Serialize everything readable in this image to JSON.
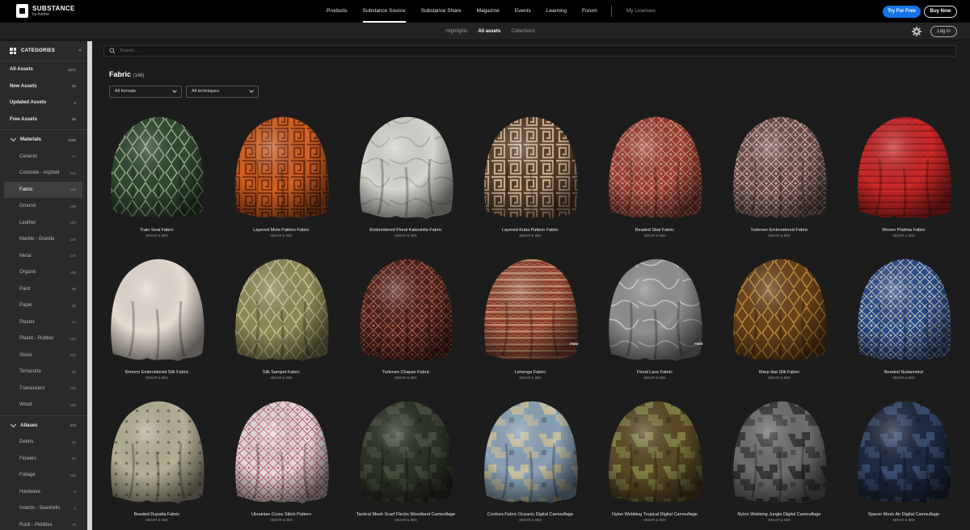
{
  "brand": {
    "name": "SUBSTANCE",
    "byline": "by Adobe"
  },
  "nav": [
    {
      "label": "Products",
      "active": false
    },
    {
      "label": "Substance Source",
      "active": true
    },
    {
      "label": "Substance Share",
      "active": false
    },
    {
      "label": "Magazine",
      "active": false
    },
    {
      "label": "Events",
      "active": false
    },
    {
      "label": "Learning",
      "active": false
    },
    {
      "label": "Forum",
      "active": false
    }
  ],
  "nav_secondary": "My Licenses",
  "cta": {
    "try": "Try For Free",
    "buy": "Buy Now"
  },
  "subtabs": [
    {
      "label": "Highlights",
      "active": false
    },
    {
      "label": "All assets",
      "active": true
    },
    {
      "label": "Collections",
      "active": false
    }
  ],
  "account": {
    "login": "Log in"
  },
  "sidebar": {
    "title": "CATEGORIES",
    "collapse": "«",
    "top": [
      {
        "label": "All Assets",
        "count": "1471"
      },
      {
        "label": "New Assets",
        "count": "31"
      },
      {
        "label": "Updated Assets",
        "count": "3"
      },
      {
        "label": "Free Assets",
        "count": "56"
      }
    ],
    "materials": {
      "label": "Materials",
      "count": "1005"
    },
    "material_items": [
      {
        "label": "Ceramic",
        "count": "47"
      },
      {
        "label": "Concrete - Asphalt",
        "count": "210"
      },
      {
        "label": "Fabric",
        "count": "146"
      },
      {
        "label": "Ground",
        "count": "186"
      },
      {
        "label": "Leather",
        "count": "104"
      },
      {
        "label": "Marble - Granite",
        "count": "109"
      },
      {
        "label": "Metal",
        "count": "176"
      },
      {
        "label": "Organic",
        "count": "108"
      },
      {
        "label": "Paint",
        "count": "58"
      },
      {
        "label": "Paper",
        "count": "35"
      },
      {
        "label": "Plaster",
        "count": "44"
      },
      {
        "label": "Plastic - Rubber",
        "count": "107"
      },
      {
        "label": "Stone",
        "count": "222"
      },
      {
        "label": "Terracotta",
        "count": "50"
      },
      {
        "label": "Translucent",
        "count": "103"
      },
      {
        "label": "Wood",
        "count": "150"
      }
    ],
    "atlases": {
      "label": "Atlases",
      "count": "474"
    },
    "atlas_items": [
      {
        "label": "Debris",
        "count": "33"
      },
      {
        "label": "Flowers",
        "count": "52"
      },
      {
        "label": "Foliage",
        "count": "220"
      },
      {
        "label": "Hardware",
        "count": "9"
      },
      {
        "label": "Insects - Seashells",
        "count": "3"
      },
      {
        "label": "Rock - Pebbles",
        "count": "78"
      }
    ]
  },
  "search": {
    "placeholder": "Search..."
  },
  "page": {
    "title": "Fabric",
    "count": "(146)"
  },
  "filters": {
    "formats": "All formats",
    "techniques": "All techniques"
  },
  "assets": [
    {
      "name": "Train Seat Fabric",
      "meta": "SBSAR & SBS",
      "free": false,
      "base": "#2f4a2f",
      "accent": "#b9c7a6",
      "pattern": "diamond"
    },
    {
      "name": "Layered Mola Pattern Fabric",
      "meta": "SBSAR & SBS",
      "free": false,
      "base": "#d9621e",
      "accent": "#6d2a16",
      "pattern": "maze"
    },
    {
      "name": "Embroidered Floral Kakeshita Fabric",
      "meta": "SBSAR & SBS",
      "free": false,
      "base": "#d6d6d0",
      "accent": "#a7a79b",
      "pattern": "marble"
    },
    {
      "name": "Layered Kuba Pattern Fabric",
      "meta": "SBSAR & SBS",
      "free": false,
      "base": "#5a3c26",
      "accent": "#d8c7a8",
      "pattern": "maze"
    },
    {
      "name": "Beaded Sbai Fabric",
      "meta": "SBSAR & SBS",
      "free": false,
      "base": "#9b3a2e",
      "accent": "#d9b8a2",
      "pattern": "lattice"
    },
    {
      "name": "Turkmen Embroidered Fabric",
      "meta": "SBSAR & SBS",
      "free": false,
      "base": "#6b4a45",
      "accent": "#e6d8d0",
      "pattern": "lattice"
    },
    {
      "name": "Woven Plakhta Fabric",
      "meta": "SBSAR & SBS",
      "free": false,
      "base": "#d42a2a",
      "accent": "#8e1717",
      "pattern": "stripes"
    },
    {
      "name": "Kimono Embroidered Silk Fabric",
      "meta": "SBSAR & SBS",
      "free": false,
      "base": "#e6dcd2",
      "accent": "#cfc2b6",
      "pattern": "plain"
    },
    {
      "name": "Silk Sampot Fabric",
      "meta": "SBSAR & SBS",
      "free": false,
      "base": "#8f8a57",
      "accent": "#d8d6a8",
      "pattern": "diamond"
    },
    {
      "name": "Turkmen Chapan Fabric",
      "meta": "SBSAR & SBS",
      "free": false,
      "base": "#4a1e1a",
      "accent": "#c87858",
      "pattern": "lattice"
    },
    {
      "name": "Lehenga Fabric",
      "meta": "SBSAR & SBS",
      "free": true,
      "base": "#8c3d2c",
      "accent": "#d8ad83",
      "pattern": "stripes"
    },
    {
      "name": "Floral Lace Fabric",
      "meta": "SBSAR & SBS",
      "free": true,
      "base": "#8f8f8f",
      "accent": "#d9d9d9",
      "pattern": "marble"
    },
    {
      "name": "Warp Ikat Silk Fabric",
      "meta": "SBSAR & SBS",
      "free": false,
      "base": "#6a4219",
      "accent": "#d6a244",
      "pattern": "diamond"
    },
    {
      "name": "Beaded Nuiiammiut",
      "meta": "SBSAR & SBS",
      "free": false,
      "base": "#284a8a",
      "accent": "#e8e0c8",
      "pattern": "lattice"
    },
    {
      "name": "Beaded Dupatta Fabric",
      "meta": "SBSAR & SBS",
      "free": false,
      "base": "#b5b095",
      "accent": "#6d6a4f",
      "pattern": "dots"
    },
    {
      "name": "Ukrainian Cross Stitch Pattern",
      "meta": "SBSAR & SBS",
      "free": false,
      "base": "#e8dede",
      "accent": "#b34a5e",
      "pattern": "lattice"
    },
    {
      "name": "Tactical Mesh Scarf Flecks Woodland Camouflage",
      "meta": "SBSAR & SBS",
      "free": false,
      "base": "#2d3326",
      "accent": "#4b5240",
      "pattern": "camo"
    },
    {
      "name": "Cordura Fabric Oceanic Digital Camouflage",
      "meta": "SBSAR & SBS",
      "free": false,
      "base": "#8aa3b8",
      "accent": "#d4c89a",
      "pattern": "camo"
    },
    {
      "name": "Nylon Webbing Tropical Digital Camouflage",
      "meta": "SBSAR & SBS",
      "free": false,
      "base": "#5c4a26",
      "accent": "#8a8a4a",
      "pattern": "camo"
    },
    {
      "name": "Nylon Webbing Jungle Digital Camouflage",
      "meta": "SBSAR & SBS",
      "free": false,
      "base": "#6e6e6e",
      "accent": "#2a2a2a",
      "pattern": "camo"
    },
    {
      "name": "Spacer Mesh Air Digital Camouflage",
      "meta": "SBSAR & SBS",
      "free": false,
      "base": "#1e2a40",
      "accent": "#3f5578",
      "pattern": "camo"
    }
  ],
  "free_label": "FREE"
}
